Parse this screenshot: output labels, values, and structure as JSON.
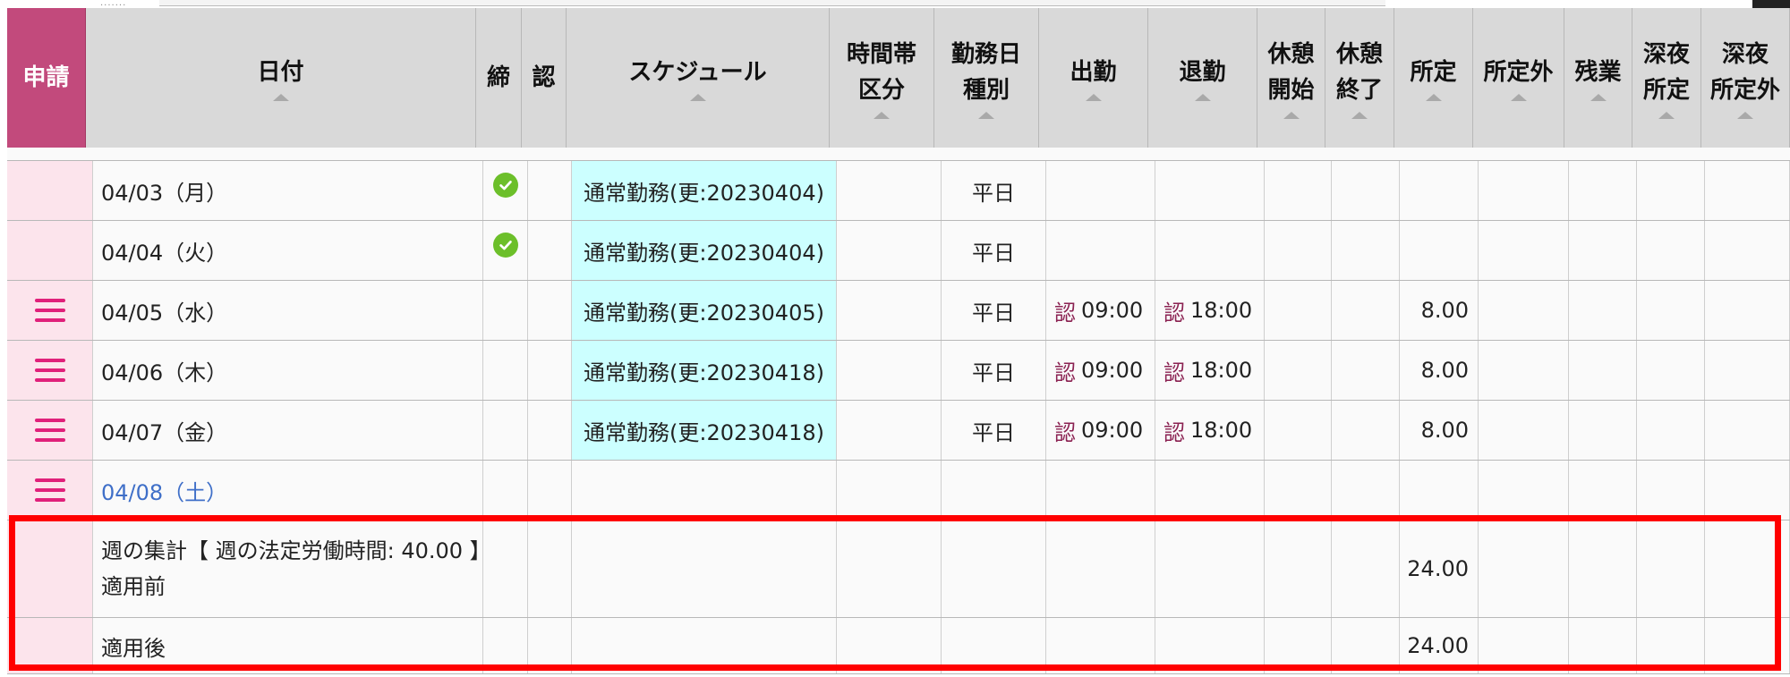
{
  "header": {
    "shinsei": "申請",
    "date": "日付",
    "shime": "締",
    "nin": "認",
    "schedule": "スケジュール",
    "jikantai_1": "時間帯",
    "jikantai_2": "区分",
    "kinmubi_1": "勤務日",
    "kinmubi_2": "種別",
    "shukkin": "出勤",
    "taikin": "退勤",
    "kyukei_start_1": "休憩",
    "kyukei_start_2": "開始",
    "kyukei_end_1": "休憩",
    "kyukei_end_2": "終了",
    "shotei": "所定",
    "shoteigai": "所定外",
    "zangyo": "残業",
    "shinya_shotei_1": "深夜",
    "shinya_shotei_2": "所定",
    "shinya_shoteigai_1": "深夜",
    "shinya_shoteigai_2": "所定外"
  },
  "rows": [
    {
      "date": "04/03（月）",
      "closed": true,
      "menu": false,
      "schedule": "通常勤務(更:20230404)",
      "day_type": "平日",
      "in_mark": "",
      "in": "",
      "out_mark": "",
      "out": "",
      "shotei": ""
    },
    {
      "date": "04/04（火）",
      "closed": true,
      "menu": false,
      "schedule": "通常勤務(更:20230404)",
      "day_type": "平日",
      "in_mark": "",
      "in": "",
      "out_mark": "",
      "out": "",
      "shotei": ""
    },
    {
      "date": "04/05（水）",
      "closed": false,
      "menu": true,
      "schedule": "通常勤務(更:20230405)",
      "day_type": "平日",
      "in_mark": "認",
      "in": "09:00",
      "out_mark": "認",
      "out": "18:00",
      "shotei": "8.00"
    },
    {
      "date": "04/06（木）",
      "closed": false,
      "menu": true,
      "schedule": "通常勤務(更:20230418)",
      "day_type": "平日",
      "in_mark": "認",
      "in": "09:00",
      "out_mark": "認",
      "out": "18:00",
      "shotei": "8.00"
    },
    {
      "date": "04/07（金）",
      "closed": false,
      "menu": true,
      "schedule": "通常勤務(更:20230418)",
      "day_type": "平日",
      "in_mark": "認",
      "in": "09:00",
      "out_mark": "認",
      "out": "18:00",
      "shotei": "8.00"
    },
    {
      "date": "04/08（土）",
      "closed": false,
      "menu": true,
      "schedule": "",
      "day_type": "",
      "in_mark": "",
      "in": "",
      "out_mark": "",
      "out": "",
      "shotei": ""
    }
  ],
  "summary": {
    "line1": "週の集計【 週の法定労働時間: 40.00 】",
    "before_label": "適用前",
    "before_shotei": "24.00",
    "after_label": "適用後",
    "after_shotei": "24.00"
  },
  "colors": {
    "shinsei_header": "#c24a7c",
    "first_col": "#fce4ec",
    "schedule_bg": "#ccffff",
    "menu_icon": "#e0207a",
    "check_icon": "#6cbf2a",
    "saturday": "#3f6fc8",
    "highlight_box": "#ff0000"
  }
}
